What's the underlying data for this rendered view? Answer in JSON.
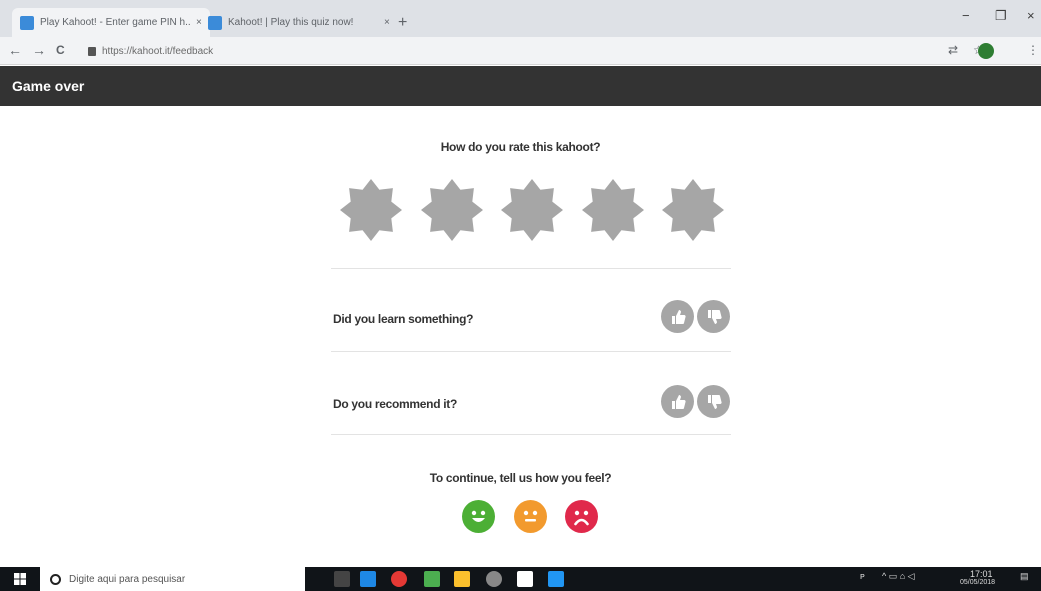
{
  "browser": {
    "tabs": [
      {
        "title": "Play Kahoot! - Enter game PIN h...",
        "close": "×"
      },
      {
        "title": "Kahoot! | Play this quiz now!",
        "close": "×"
      }
    ],
    "new_tab": "+",
    "window_controls": {
      "minimize": "−",
      "maximize": "❐",
      "close": "×"
    },
    "url": "https://kahoot.it/feedback",
    "nav": {
      "back": "←",
      "forward": "→",
      "reload": "C"
    }
  },
  "header": {
    "title": "Game over"
  },
  "rating": {
    "question": "How do you rate this kahoot?",
    "stars": 5,
    "selected": 0,
    "star_color": "#a6a6a6"
  },
  "questions": [
    {
      "text": "Did you learn something?",
      "up_icon": "thumb-up-icon",
      "down_icon": "thumb-down-icon"
    },
    {
      "text": "Do you recommend it?",
      "up_icon": "thumb-up-icon",
      "down_icon": "thumb-down-icon"
    }
  ],
  "feeling": {
    "question": "To continue, tell us how you feel?",
    "faces": [
      {
        "name": "happy-face-icon",
        "color": "#4caf35"
      },
      {
        "name": "neutral-face-icon",
        "color": "#f29a2e"
      },
      {
        "name": "sad-face-icon",
        "color": "#e0294b"
      }
    ]
  },
  "taskbar": {
    "search_placeholder": "Digite aqui para pesquisar",
    "clock_time": "17:01",
    "clock_date": "05/05/2018"
  }
}
